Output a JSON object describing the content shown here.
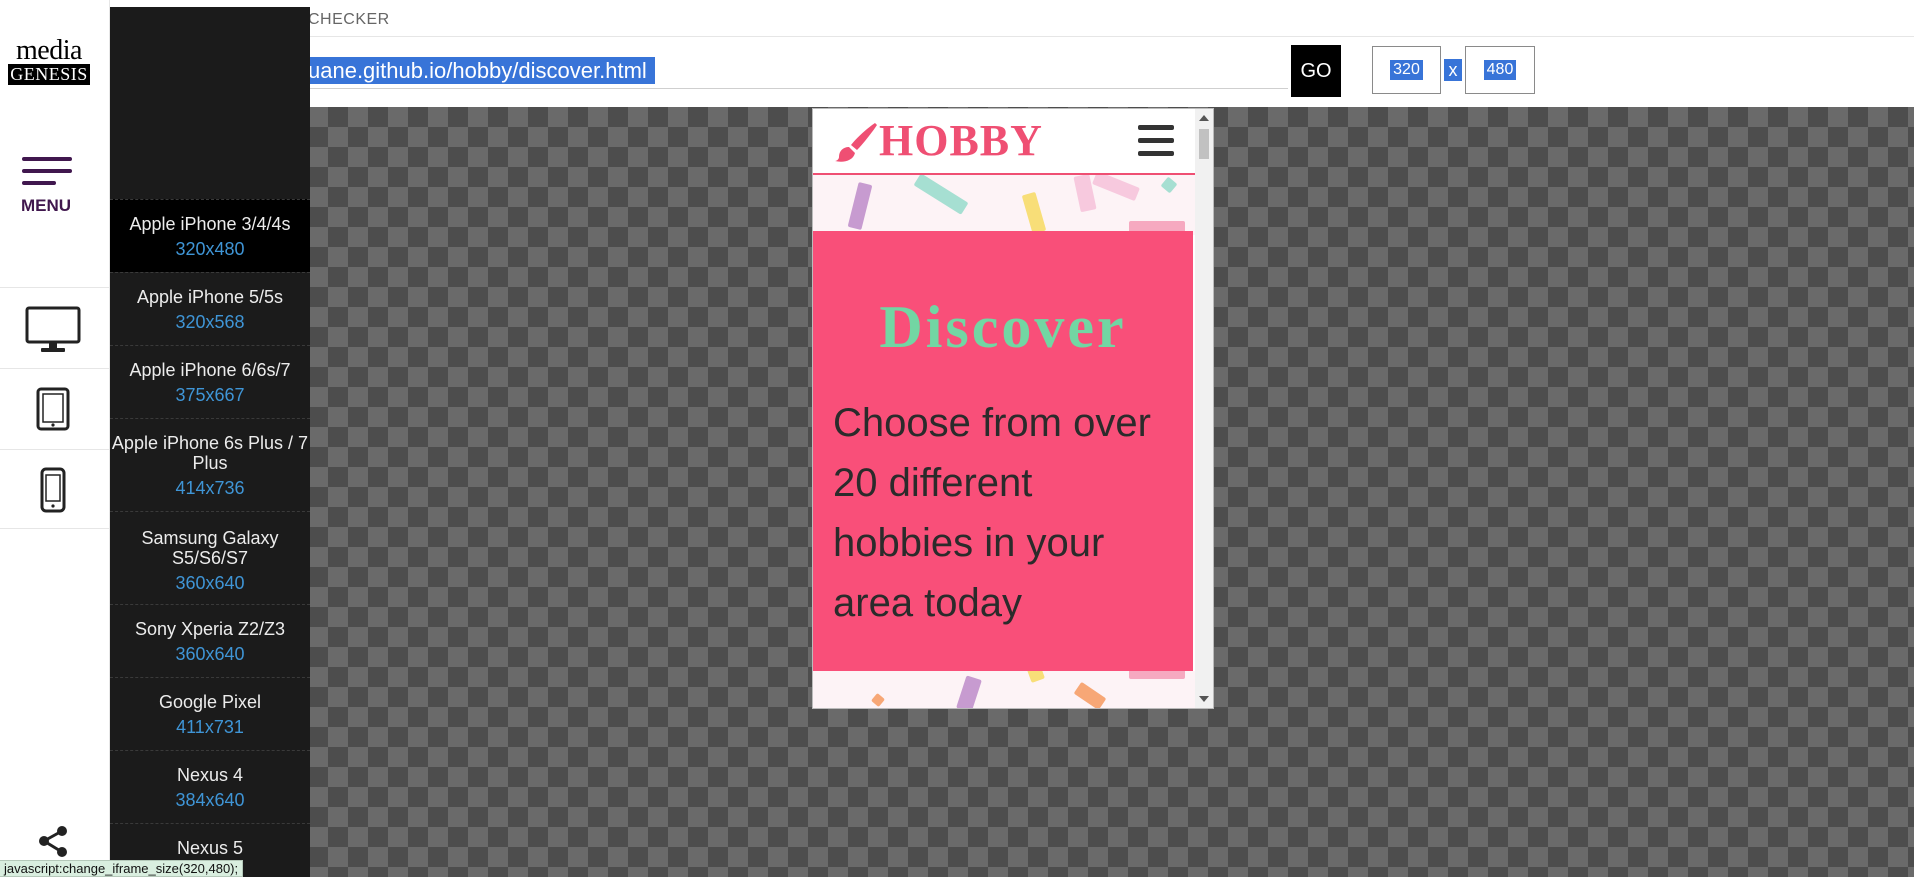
{
  "app": {
    "title_fragment": "CHECKER",
    "logo_top": "media",
    "logo_bottom": "GENESIS",
    "menu_label": "MENU"
  },
  "urlbar": {
    "value": "uane.github.io/hobby/discover.html",
    "go_label": "GO",
    "width_value": "320",
    "height_value": "480",
    "separator": "x"
  },
  "sidebar_icons": [
    "monitor-icon",
    "tablet-icon",
    "phone-icon",
    "share-icon"
  ],
  "devices": [
    {
      "name": "Apple iPhone 3/4/4s",
      "res": "320x480",
      "active": true
    },
    {
      "name": "Apple iPhone 5/5s",
      "res": "320x568"
    },
    {
      "name": "Apple iPhone 6/6s/7",
      "res": "375x667"
    },
    {
      "name": "Apple iPhone 6s Plus / 7 Plus",
      "res": "414x736"
    },
    {
      "name": "Samsung Galaxy S5/S6/S7",
      "res": "360x640"
    },
    {
      "name": "Sony Xperia Z2/Z3",
      "res": "360x640"
    },
    {
      "name": "Google Pixel",
      "res": "411x731"
    },
    {
      "name": "Nexus 4",
      "res": "384x640"
    },
    {
      "name": "Nexus 5",
      "res": ""
    }
  ],
  "preview": {
    "brand": "HOBBY",
    "heading": "Discover",
    "body": "Choose from over 20 different hobbies in your area today",
    "colors": {
      "brand": "#ef4f73",
      "card": "#f94f79",
      "heading": "#72d6a3"
    }
  },
  "status_text": "javascript:change_iframe_size(320,480);"
}
